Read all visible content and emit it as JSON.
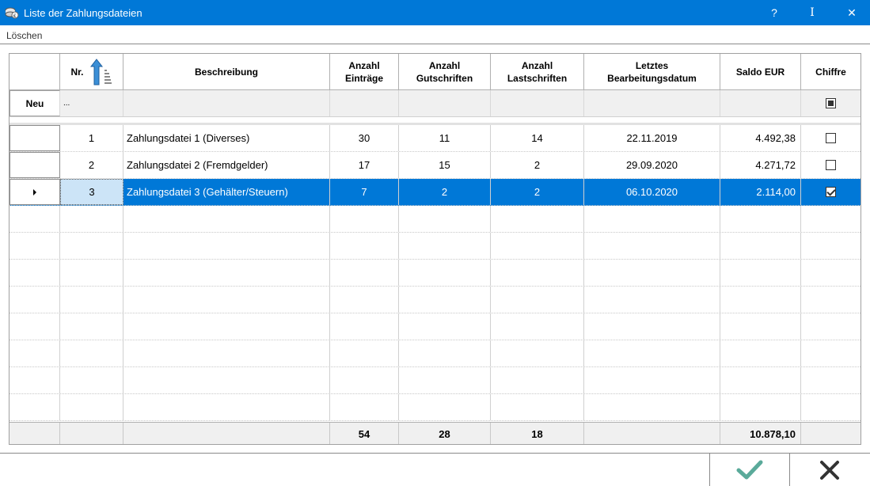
{
  "window": {
    "title": "Liste der Zahlungsdateien",
    "help_label": "?",
    "pin_label": "I",
    "close_label": "✕"
  },
  "menu": {
    "items": [
      {
        "label": "Löschen"
      }
    ]
  },
  "table": {
    "headers": {
      "nr": "Nr.",
      "beschreibung": "Beschreibung",
      "eintraege": "Anzahl\nEinträge",
      "gutschriften": "Anzahl\nGutschriften",
      "lastschriften": "Anzahl\nLastschriften",
      "datum": "Letztes\nBearbeitungsdatum",
      "saldo": "Saldo EUR",
      "chiffre": "Chiffre"
    },
    "new_row": {
      "button_label": "Neu",
      "nr_placeholder": "...",
      "chiffre_state": "indeterminate"
    },
    "rows": [
      {
        "nr": "1",
        "beschreibung": "Zahlungsdatei 1 (Diverses)",
        "eintraege": "30",
        "gutschriften": "11",
        "lastschriften": "14",
        "datum": "22.11.2019",
        "saldo": "4.492,38",
        "chiffre": false,
        "selected": false
      },
      {
        "nr": "2",
        "beschreibung": "Zahlungsdatei 2 (Fremdgelder)",
        "eintraege": "17",
        "gutschriften": "15",
        "lastschriften": "2",
        "datum": "29.09.2020",
        "saldo": "4.271,72",
        "chiffre": false,
        "selected": false
      },
      {
        "nr": "3",
        "beschreibung": "Zahlungsdatei 3 (Gehälter/Steuern)",
        "eintraege": "7",
        "gutschriften": "2",
        "lastschriften": "2",
        "datum": "06.10.2020",
        "saldo": "2.114,00",
        "chiffre": true,
        "selected": true
      }
    ],
    "totals": {
      "eintraege": "54",
      "gutschriften": "28",
      "lastschriften": "18",
      "saldo": "10.878,10"
    },
    "sort": {
      "column": "nr",
      "direction": "ascending",
      "icon": "sort-ascending-icon"
    }
  },
  "buttons": {
    "ok_icon": "checkmark-icon",
    "cancel_icon": "close-x-icon"
  },
  "colors": {
    "titlebar": "#0078d7",
    "selection": "#0078d7",
    "ok": "#5aaa9a",
    "cancel": "#333333"
  }
}
